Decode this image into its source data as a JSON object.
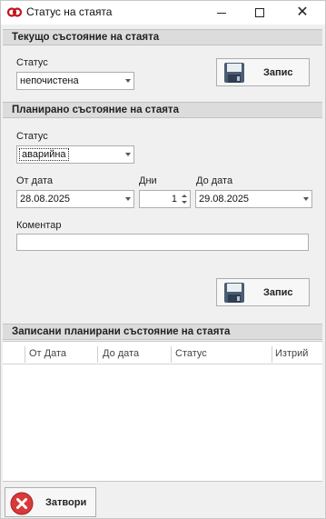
{
  "window": {
    "title": "Статус на стаята"
  },
  "current": {
    "header": "Текущо състояние на стаята",
    "status_label": "Статус",
    "status_value": "непочистена",
    "save_label": "Запис"
  },
  "planned": {
    "header": "Планирано състояние на стаята",
    "status_label": "Статус",
    "status_value": "аварийна",
    "from_label": "От дата",
    "from_value": "28.08.2025",
    "days_label": "Дни",
    "days_value": "1",
    "to_label": "До дата",
    "to_value": "29.08.2025",
    "comment_label": "Коментар",
    "comment_value": "",
    "save_label": "Запис"
  },
  "records": {
    "header": "Записани планирани състояние на стаята",
    "columns": [
      "От Дата",
      "До дата",
      "Статус",
      "Изтрий"
    ],
    "rows": []
  },
  "footer": {
    "close_label": "Затвори"
  }
}
